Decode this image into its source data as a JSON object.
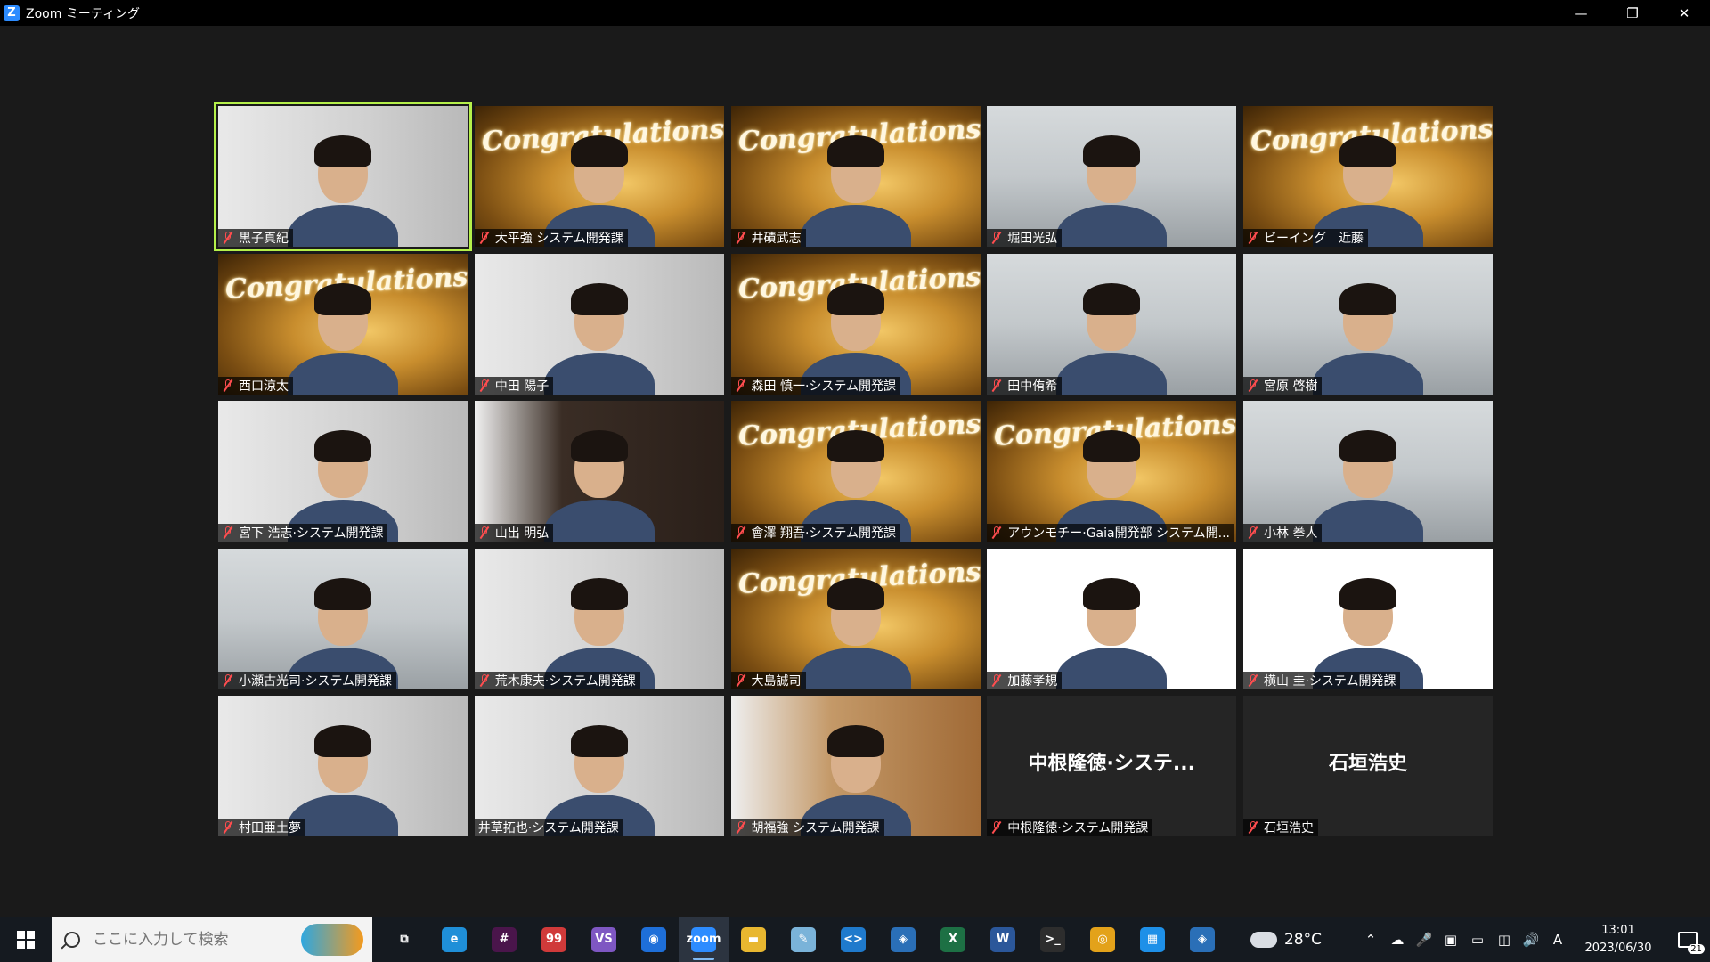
{
  "window": {
    "app_icon": "zoom-icon",
    "title": "Zoom ミーティング",
    "controls": [
      "minimize",
      "restore",
      "close"
    ]
  },
  "meeting": {
    "congrats_text": "Congratulations!",
    "participants": [
      {
        "name": "黒子真紀",
        "muted": true,
        "background": "room",
        "active": true
      },
      {
        "name": "大平強 システム開発課",
        "muted": true,
        "background": "congrats"
      },
      {
        "name": "井磧武志",
        "muted": true,
        "background": "congrats"
      },
      {
        "name": "堀田光弘",
        "muted": true,
        "background": "office"
      },
      {
        "name": "ビーイング　近藤",
        "muted": true,
        "background": "congrats"
      },
      {
        "name": "西口涼太",
        "muted": true,
        "background": "congrats"
      },
      {
        "name": "中田 陽子",
        "muted": true,
        "background": "room"
      },
      {
        "name": "森田 慎一·システム開発課",
        "muted": true,
        "background": "congrats"
      },
      {
        "name": "田中侑希",
        "muted": true,
        "background": "office"
      },
      {
        "name": "宮原 啓樹",
        "muted": true,
        "background": "office"
      },
      {
        "name": "宮下 浩志·システム開発課",
        "muted": true,
        "background": "room"
      },
      {
        "name": "山出 明弘",
        "muted": true,
        "background": "dark"
      },
      {
        "name": "會澤 翔吾·システム開発課",
        "muted": true,
        "background": "congrats"
      },
      {
        "name": "アウンモチー·Gaia開発部 システム開...",
        "muted": true,
        "background": "congrats"
      },
      {
        "name": "小林 拳人",
        "muted": true,
        "background": "office"
      },
      {
        "name": "小瀬古光司·システム開発課",
        "muted": true,
        "background": "office"
      },
      {
        "name": "荒木康夫·システム開発課",
        "muted": true,
        "background": "room"
      },
      {
        "name": "大島誠司",
        "muted": true,
        "background": "congrats"
      },
      {
        "name": "加藤孝規",
        "muted": true,
        "background": "white"
      },
      {
        "name": "横山 圭·システム開発課",
        "muted": true,
        "background": "white"
      },
      {
        "name": "村田亜土夢",
        "muted": true,
        "background": "room"
      },
      {
        "name": "井草拓也·システム開発課",
        "muted": false,
        "background": "room"
      },
      {
        "name": "胡福強 システム開発課",
        "muted": true,
        "background": "wood"
      },
      {
        "name": "中根隆徳·システム開発課",
        "muted": true,
        "background": "none",
        "video_off_label": "中根隆徳·システ..."
      },
      {
        "name": "石垣浩史",
        "muted": true,
        "background": "none",
        "video_off_label": "石垣浩史"
      }
    ]
  },
  "taskbar": {
    "search_placeholder": "ここに入力して検索",
    "apps": [
      {
        "name": "task-view-icon",
        "label": "⧉",
        "color": "#151a20"
      },
      {
        "name": "edge-icon",
        "label": "e",
        "color": "#1f8fd8"
      },
      {
        "name": "slack-icon",
        "label": "#",
        "color": "#4a154b"
      },
      {
        "name": "chat-icon",
        "label": "99",
        "color": "#d03a3a"
      },
      {
        "name": "visual-studio-icon",
        "label": "VS",
        "color": "#7e57c2"
      },
      {
        "name": "maps-icon",
        "label": "◉",
        "color": "#1e6fd9"
      },
      {
        "name": "zoom-icon",
        "label": "zoom",
        "color": "#2d8cff",
        "active": true
      },
      {
        "name": "file-explorer-icon",
        "label": "▬",
        "color": "#e8b730"
      },
      {
        "name": "notepad-icon",
        "label": "✎",
        "color": "#7ab3d9"
      },
      {
        "name": "vscode-icon",
        "label": "<>",
        "color": "#1f7acc"
      },
      {
        "name": "network-icon",
        "label": "◈",
        "color": "#2a6fb7"
      },
      {
        "name": "excel-icon",
        "label": "X",
        "color": "#1d7044"
      },
      {
        "name": "word-icon",
        "label": "W",
        "color": "#2b579a"
      },
      {
        "name": "terminal-icon",
        "label": ">_",
        "color": "#2d2d2d"
      },
      {
        "name": "chrome-icon",
        "label": "◎",
        "color": "#e3a21a"
      },
      {
        "name": "calendar-icon",
        "label": "▦",
        "color": "#1e90e8"
      },
      {
        "name": "network-icon",
        "label": "◈",
        "color": "#2a6fb7"
      }
    ],
    "weather": {
      "temperature": "28°C"
    },
    "tray_icons": [
      "chevron-up-icon",
      "onedrive-icon",
      "microphone-icon",
      "display-icon",
      "battery-icon",
      "network-icon",
      "volume-icon"
    ],
    "ime": "A",
    "time": "13:01",
    "date": "2023/06/30",
    "notifications": "21"
  }
}
